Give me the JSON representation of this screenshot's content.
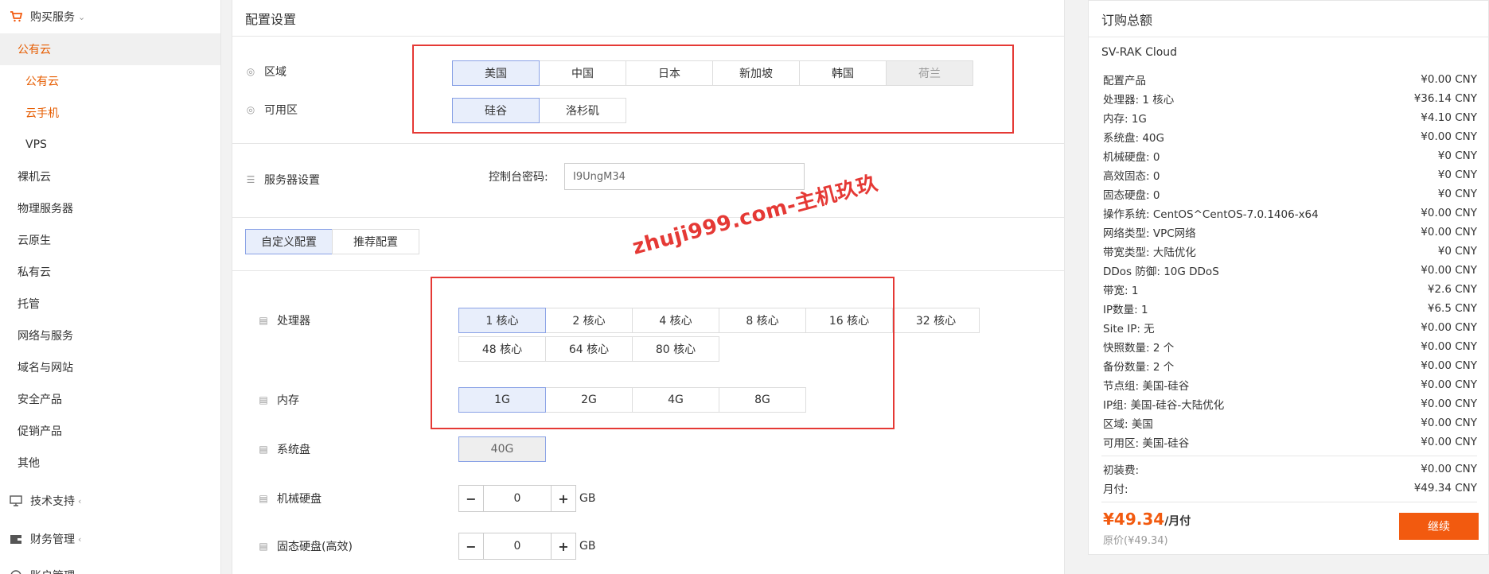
{
  "sidebar": {
    "buy_services": "购买服务",
    "public_cloud_header": "公有云",
    "sub_public_cloud": "公有云",
    "sub_cloud_phone": "云手机",
    "sub_vps": "VPS",
    "items": [
      "裸机云",
      "物理服务器",
      "云原生",
      "私有云",
      "托管",
      "网络与服务",
      "域名与网站",
      "安全产品",
      "促销产品",
      "其他"
    ],
    "tech_support": "技术支持",
    "finance": "财务管理",
    "account": "账户管理"
  },
  "config": {
    "title": "配置设置",
    "region_label": "区域",
    "regions": [
      "美国",
      "中国",
      "日本",
      "新加坡",
      "韩国",
      "荷兰"
    ],
    "zone_label": "可用区",
    "zones": [
      "硅谷",
      "洛杉矶"
    ],
    "server_settings_label": "服务器设置",
    "console_password_label": "控制台密码:",
    "console_password_value": "I9UngM34",
    "tab_custom": "自定义配置",
    "tab_recommended": "推荐配置",
    "cpu_label": "处理器",
    "cpu_options": [
      "1 核心",
      "2 核心",
      "4 核心",
      "8 核心",
      "16 核心",
      "32 核心",
      "48 核心",
      "64 核心",
      "80 核心"
    ],
    "memory_label": "内存",
    "memory_options": [
      "1G",
      "2G",
      "4G",
      "8G"
    ],
    "system_disk_label": "系统盘",
    "system_disk_value": "40G",
    "hdd_label": "机械硬盘",
    "hdd_value": "0",
    "ssd_label": "固态硬盘(高效)",
    "ssd_value": "0",
    "unit_gb": "GB",
    "minus": "−",
    "plus": "+"
  },
  "watermark": "zhuji999.com-主机玖玖",
  "summary": {
    "title": "订购总额",
    "brand": "SV-RAK Cloud",
    "rows": [
      {
        "label": "配置产品",
        "value": "¥0.00 CNY"
      },
      {
        "label": "处理器: 1 核心",
        "value": "¥36.14 CNY"
      },
      {
        "label": "内存: 1G",
        "value": "¥4.10 CNY"
      },
      {
        "label": "系统盘: 40G",
        "value": "¥0.00 CNY"
      },
      {
        "label": "机械硬盘: 0",
        "value": "¥0 CNY"
      },
      {
        "label": "高效固态: 0",
        "value": "¥0 CNY"
      },
      {
        "label": "固态硬盘: 0",
        "value": "¥0 CNY"
      },
      {
        "label": "操作系统: CentOS^CentOS-7.0.1406-x64",
        "value": "¥0.00 CNY"
      },
      {
        "label": "网络类型: VPC网络",
        "value": "¥0.00 CNY"
      },
      {
        "label": "带宽类型: 大陆优化",
        "value": "¥0 CNY"
      },
      {
        "label": "DDos 防御: 10G DDoS",
        "value": "¥0.00 CNY"
      },
      {
        "label": "带宽: 1",
        "value": "¥2.6 CNY"
      },
      {
        "label": "IP数量: 1",
        "value": "¥6.5 CNY"
      },
      {
        "label": "Site IP: 无",
        "value": "¥0.00 CNY"
      },
      {
        "label": "快照数量: 2 个",
        "value": "¥0.00 CNY"
      },
      {
        "label": "备份数量: 2 个",
        "value": "¥0.00 CNY"
      },
      {
        "label": "节点组: 美国-硅谷",
        "value": "¥0.00 CNY"
      },
      {
        "label": "IP组: 美国-硅谷-大陆优化",
        "value": "¥0.00 CNY"
      },
      {
        "label": "区域: 美国",
        "value": "¥0.00 CNY"
      },
      {
        "label": "可用区: 美国-硅谷",
        "value": "¥0.00 CNY"
      }
    ],
    "setup_fee_label": "初装费:",
    "setup_fee_value": "¥0.00 CNY",
    "monthly_label": "月付:",
    "monthly_value": "¥49.34 CNY",
    "total_price": "¥49.34",
    "total_unit": "/月付",
    "original_price": "原价(¥49.34)",
    "continue_label": "继续"
  },
  "colors": {
    "accent_orange": "#f25a0f",
    "selected_bg": "#e8eefb",
    "selected_border": "#8aa2e6",
    "highlight_red": "#e53935"
  }
}
